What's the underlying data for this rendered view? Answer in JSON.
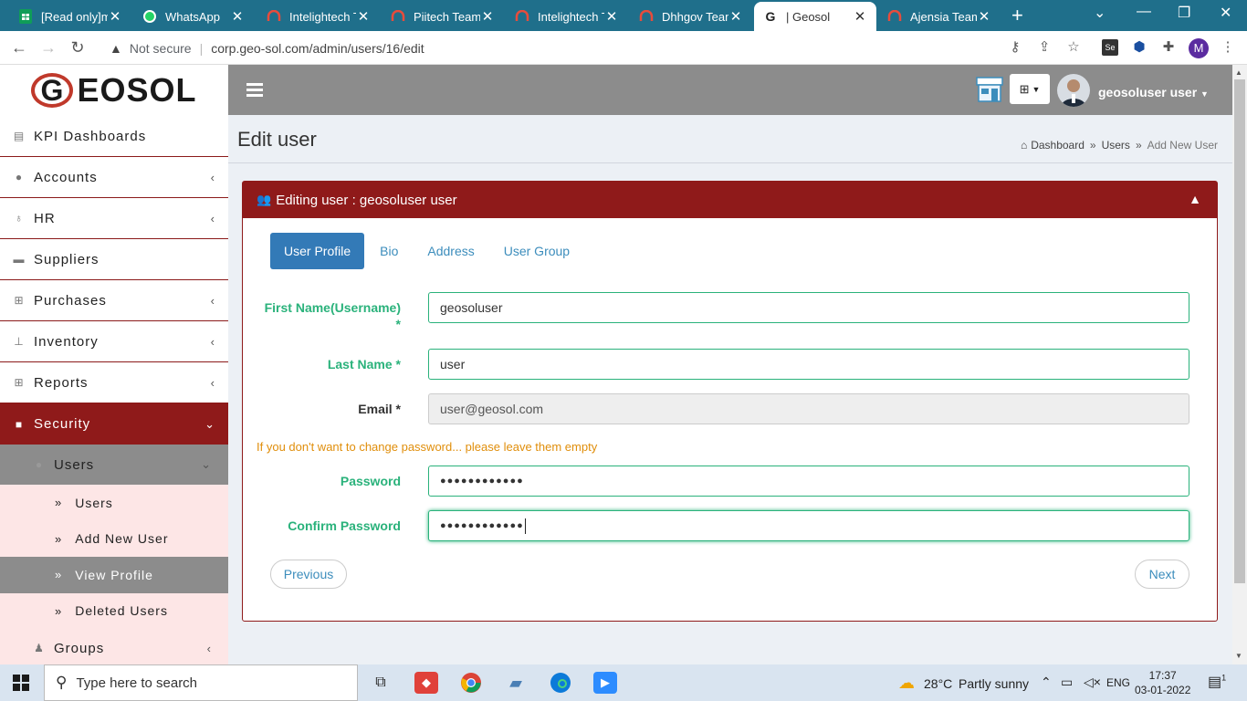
{
  "browser": {
    "tabs": [
      {
        "label": "[Read only]m",
        "icon": "sheets-icon",
        "color": "#0f9d58"
      },
      {
        "label": "WhatsApp",
        "icon": "whatsapp-icon",
        "color": "#25d366"
      },
      {
        "label": "Intelightech T",
        "icon": "teams-headset-icon",
        "color": "#c0392b"
      },
      {
        "label": "Piitech Teams",
        "icon": "teams-headset-icon",
        "color": "#c0392b"
      },
      {
        "label": "Intelightech T",
        "icon": "teams-headset-icon",
        "color": "#c0392b"
      },
      {
        "label": "Dhhgov Team",
        "icon": "teams-headset-icon",
        "color": "#c0392b"
      },
      {
        "label": "| Geosol",
        "icon": "geosol-icon",
        "color": "#222222"
      },
      {
        "label": "Ajensia Teams",
        "icon": "teams-headset-icon",
        "color": "#c0392b"
      }
    ],
    "active_tab": 6,
    "security_label": "Not secure",
    "url": "corp.geo-sol.com/admin/users/16/edit",
    "profile_initial": "M"
  },
  "logo": {
    "g": "G",
    "text": "EOSOL"
  },
  "sidebar": {
    "items": [
      {
        "label": "KPI Dashboards",
        "icon": "dashboard-icon",
        "chevron": ""
      },
      {
        "label": "Accounts",
        "icon": "accounts-icon",
        "chevron": "‹"
      },
      {
        "label": "HR",
        "icon": "hr-icon",
        "chevron": "‹"
      },
      {
        "label": "Suppliers",
        "icon": "truck-icon",
        "chevron": ""
      },
      {
        "label": "Purchases",
        "icon": "cart-icon",
        "chevron": "‹"
      },
      {
        "label": "Inventory",
        "icon": "sitemap-icon",
        "chevron": "‹"
      },
      {
        "label": "Reports",
        "icon": "cart-icon",
        "chevron": "‹"
      }
    ],
    "security": {
      "label": "Security",
      "chevron": "⌄"
    },
    "users": {
      "label": "Users",
      "chevron": "⌄"
    },
    "subitems": [
      "Users",
      "Add New User",
      "View Profile",
      "Deleted Users"
    ],
    "active_subitem": 2,
    "groups": {
      "label": "Groups",
      "chevron": "‹"
    }
  },
  "topbar": {
    "username": "geosoluser user"
  },
  "page": {
    "title": "Edit user",
    "breadcrumb": [
      "Dashboard",
      "Users",
      "Add New User"
    ]
  },
  "panel": {
    "title": "Editing user : geosoluser user",
    "tabs": [
      "User Profile",
      "Bio",
      "Address",
      "User Group"
    ],
    "active_tab": 0
  },
  "form": {
    "first_name_label": "First Name(Username)",
    "first_name_req": "*",
    "first_name_value": "geosoluser",
    "last_name_label": "Last Name *",
    "last_name_value": "user",
    "email_label": "Email *",
    "email_value": "user@geosol.com",
    "hint": "If you don't want to change password... please leave them empty",
    "password_label": "Password",
    "password_value": "●●●●●●●●●●●●",
    "confirm_label": "Confirm Password",
    "confirm_value": "●●●●●●●●●●●●",
    "previous": "Previous",
    "next": "Next"
  },
  "taskbar": {
    "search_placeholder": "Type here to search",
    "weather_temp": "28°C",
    "weather_text": "Partly sunny",
    "lang": "ENG",
    "time": "17:37",
    "date": "03-01-2022",
    "notif_count": "1"
  }
}
